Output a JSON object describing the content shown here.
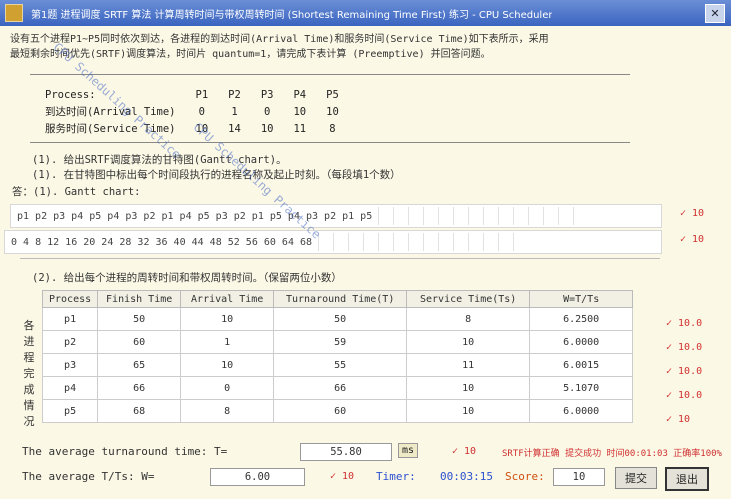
{
  "window": {
    "title": "第1题 进程调度 SRTF 算法 计算周转时间与带权周转时间 (Shortest Remaining Time First) 练习 - CPU Scheduler",
    "close": "✕"
  },
  "question": {
    "line1": "设有五个进程P1~P5同时依次到达，各进程的到达时间(Arrival Time)和服务时间(Service Time)如下表所示，采用",
    "line2": "最短剩余时间优先(SRTF)调度算法，时间片 quantum=1，请完成下表计算 (Preemptive) 并回答问题。"
  },
  "process_table": {
    "header": [
      "Process:",
      "P1",
      "P2",
      "P3",
      "P4",
      "P5"
    ],
    "rows": [
      {
        "label": "到达时间(Arrival Time)",
        "values": [
          "0",
          "1",
          "0",
          "10",
          "10"
        ]
      },
      {
        "label": "服务时间(Service Time)",
        "values": [
          "10",
          "14",
          "10",
          "11",
          "8"
        ]
      }
    ]
  },
  "q1": {
    "title": "(1). 给出SRTF调度算法的甘特图(Gantt chart)。",
    "subtitle": "(1). 在甘特图中标出每个时间段执行的进程名称及起止时刻。（每段填1个数）",
    "answer_label": "答：(1). Gantt chart:",
    "seq1": "p1 p2 p3 p4 p5 p4 p3 p2 p1 p4 p5 p3 p2 p1 p5 p4 p3 p2 p1 p5",
    "seq2": "0  4  8  12 16 20 24 28 32 36 40 44 48 52 56 60 64 68",
    "mark1": "✓ 10",
    "mark2": "✓ 10"
  },
  "q2": {
    "title": "(2). 给出每个进程的周转时间和带权周转时间。（保留两位小数）",
    "side_label": "各进程完成情况",
    "headers": [
      "Process",
      "Finish Time",
      "Arrival Time",
      "Turnaround Time(T)",
      "Service Time(Ts)",
      "W=T/Ts"
    ],
    "rows": [
      {
        "values": [
          "p1",
          "50",
          "10",
          "50",
          "8",
          "6.2500"
        ],
        "mark": "✓ 10.0"
      },
      {
        "values": [
          "p2",
          "60",
          "1",
          "59",
          "10",
          "6.0000"
        ],
        "mark": "✓ 10.0"
      },
      {
        "values": [
          "p3",
          "65",
          "10",
          "55",
          "11",
          "6.0015"
        ],
        "mark": "✓ 10.0"
      },
      {
        "values": [
          "p4",
          "66",
          "0",
          "66",
          "10",
          "5.1070"
        ],
        "mark": "✓ 10.0"
      },
      {
        "values": [
          "p5",
          "68",
          "8",
          "60",
          "10",
          "6.0000"
        ],
        "mark": "✓ 10"
      }
    ]
  },
  "summary": {
    "avg_t_label": "The average turnaround time: T=",
    "avg_t_value": "55.80",
    "avg_t_unit": "ms",
    "avg_t_mark": "✓ 10",
    "status_text": "SRTF计算正确 提交成功 时间00:01:03 正确率100%",
    "avg_w_label": "The average T/Ts: W=",
    "avg_w_value": "6.00",
    "avg_w_mark": "✓ 10",
    "timer_label": "Timer:",
    "timer_value": "00:03:15",
    "score_label": "Score:",
    "score_value": "10",
    "btn_submit": "提交",
    "btn_exit": "退出"
  },
  "watermark": "CPU Scheduling Practice"
}
